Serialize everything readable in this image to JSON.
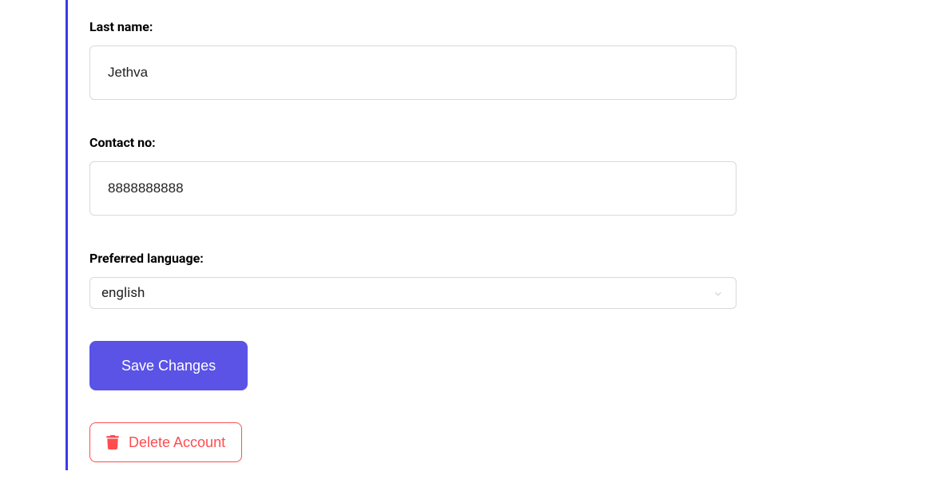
{
  "form": {
    "last_name": {
      "label": "Last name:",
      "value": "Jethva"
    },
    "contact_no": {
      "label": "Contact no:",
      "value": "8888888888"
    },
    "preferred_language": {
      "label": "Preferred language:",
      "value": "english"
    }
  },
  "buttons": {
    "save": "Save Changes",
    "delete": "Delete Account"
  }
}
